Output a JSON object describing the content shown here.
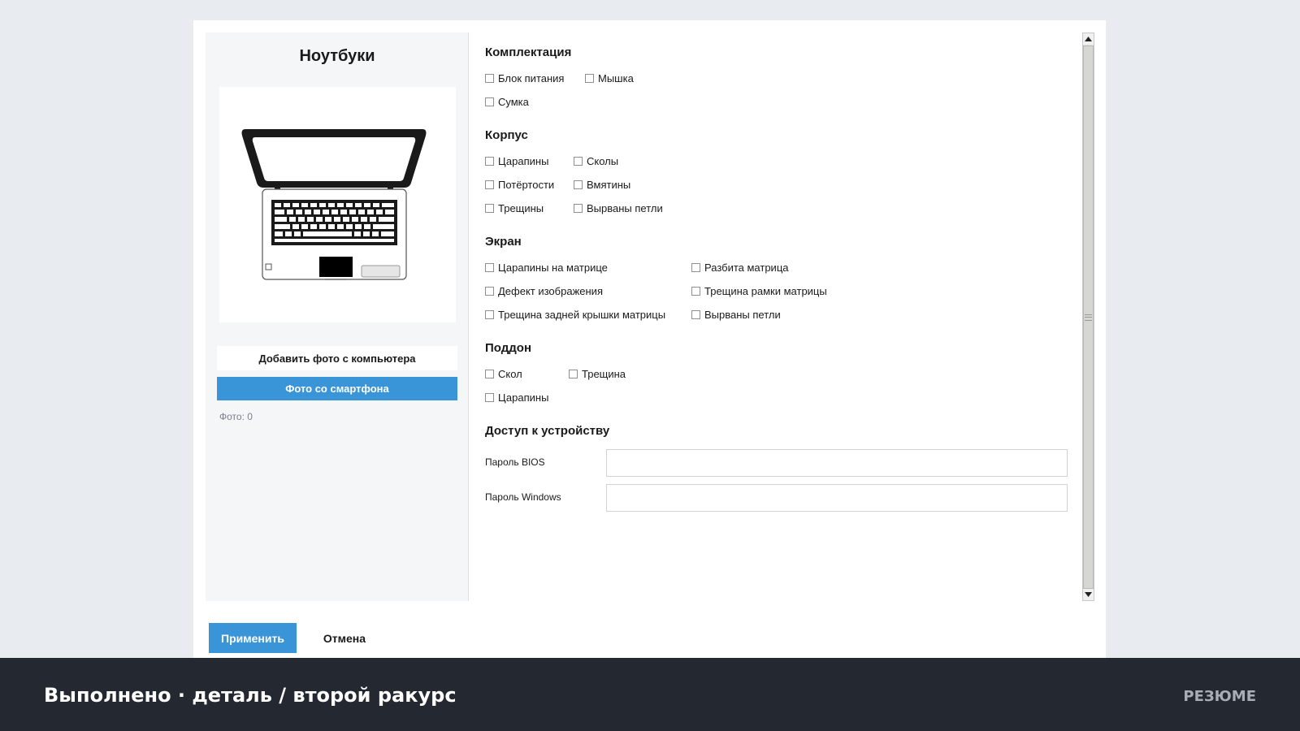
{
  "left": {
    "title": "Ноутбуки",
    "add_photo_label": "Добавить фото с компьютера",
    "phone_photo_label": "Фото со смартфона",
    "photo_count_label": "Фото:",
    "photo_count": "0"
  },
  "sections": {
    "kit": {
      "title": "Комплектация",
      "items": [
        "Блок питания",
        "Мышка",
        "Сумка"
      ]
    },
    "body": {
      "title": "Корпус",
      "items": [
        "Царапины",
        "Сколы",
        "Потёртости",
        "Вмятины",
        "Трещины",
        "Вырваны петли"
      ]
    },
    "screen": {
      "title": "Экран",
      "items": [
        "Царапины на матрице",
        "Разбита матрица",
        "Дефект изображения",
        "Трещина рамки матрицы",
        "Трещина задней крышки матрицы",
        "Вырваны петли"
      ]
    },
    "tray": {
      "title": "Поддон",
      "items": [
        "Скол",
        "Трещина",
        "Царапины"
      ]
    },
    "access": {
      "title": "Доступ к устройству",
      "bios_label": "Пароль BIOS",
      "bios_value": "",
      "windows_label": "Пароль Windows",
      "windows_value": ""
    }
  },
  "actions": {
    "apply_label": "Применить",
    "cancel_label": "Отмена"
  },
  "footer": {
    "title": "Выполнено · деталь / второй ракурс",
    "link_label": "РЕЗЮМЕ"
  },
  "colors": {
    "accent": "#3a94d8",
    "footer_bg": "#232831",
    "page_bg": "#e8ebef"
  }
}
